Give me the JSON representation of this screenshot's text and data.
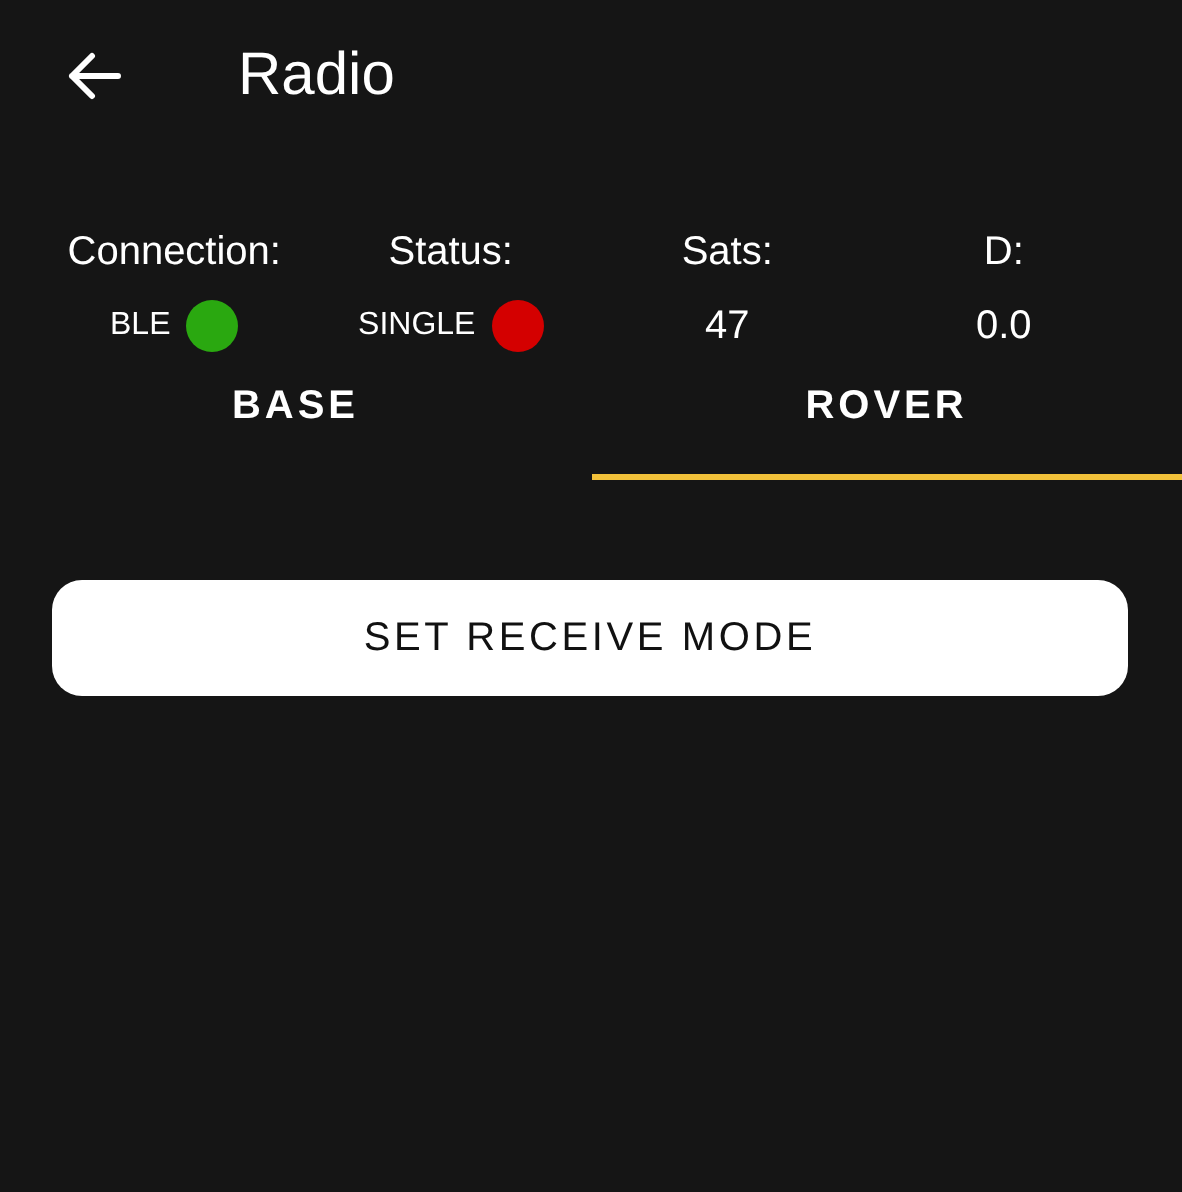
{
  "header": {
    "title": "Radio"
  },
  "stats": [
    {
      "label": "Connection:",
      "value": "BLE",
      "kind": "dot",
      "color": "#2aa810"
    },
    {
      "label": "Status:",
      "value": "SINGLE",
      "kind": "dot",
      "color": "#d40000"
    },
    {
      "label": "Sats:",
      "value": "47",
      "kind": "number"
    },
    {
      "label": "D:",
      "value": "0.0",
      "kind": "number"
    }
  ],
  "tabs": [
    {
      "label": "BASE",
      "selected": false
    },
    {
      "label": "ROVER",
      "selected": true
    }
  ],
  "button": {
    "label": "SET RECEIVE MODE"
  }
}
